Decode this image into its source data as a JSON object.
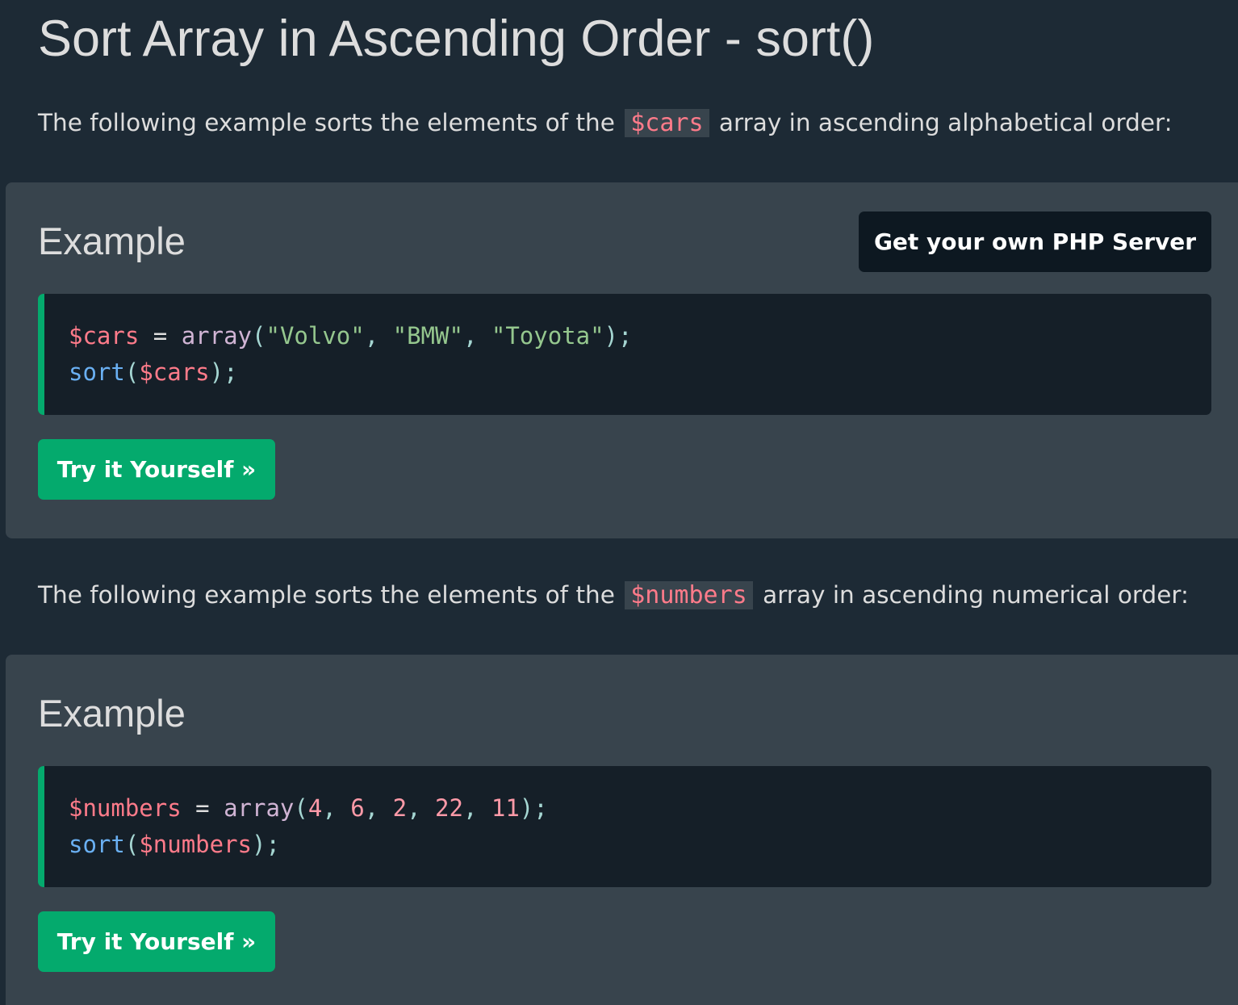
{
  "page": {
    "title": "Sort Array in Ascending Order - sort()"
  },
  "sections": [
    {
      "intro_before": "The following example sorts the elements of the ",
      "intro_code": "$cars",
      "intro_after": " array in ascending alphabetical order:",
      "example_heading": "Example",
      "server_button": "Get your own PHP Server",
      "code": {
        "line1": {
          "var": "$cars",
          "eq": " = ",
          "fn": "array",
          "open": "(",
          "arg1": "\"Volvo\"",
          "sep1": ", ",
          "arg2": "\"BMW\"",
          "sep2": ", ",
          "arg3": "\"Toyota\"",
          "close": ");"
        },
        "line2": {
          "fn": "sort",
          "open": "(",
          "var": "$cars",
          "close": ");"
        }
      },
      "try_button": "Try it Yourself »"
    },
    {
      "intro_before": "The following example sorts the elements of the ",
      "intro_code": "$numbers",
      "intro_after": " array in ascending numerical order:",
      "example_heading": "Example",
      "code": {
        "line1": {
          "var": "$numbers",
          "eq": " = ",
          "fn": "array",
          "open": "(",
          "arg1": "4",
          "sep1": ", ",
          "arg2": "6",
          "sep2": ", ",
          "arg3": "2",
          "sep3": ", ",
          "arg4": "22",
          "sep4": ", ",
          "arg5": "11",
          "close": ");"
        },
        "line2": {
          "fn": "sort",
          "open": "(",
          "var": "$numbers",
          "close": ");"
        }
      },
      "try_button": "Try it Yourself »"
    }
  ],
  "colors": {
    "page_background": "#1d2a35",
    "example_background": "#38444d",
    "code_background": "#151f28",
    "accent_green": "#04aa6d",
    "server_button_background": "#0d1821",
    "code_variable": "#ff7b8a",
    "code_string": "#95c78e",
    "code_keyword": "#6ab0f3"
  }
}
